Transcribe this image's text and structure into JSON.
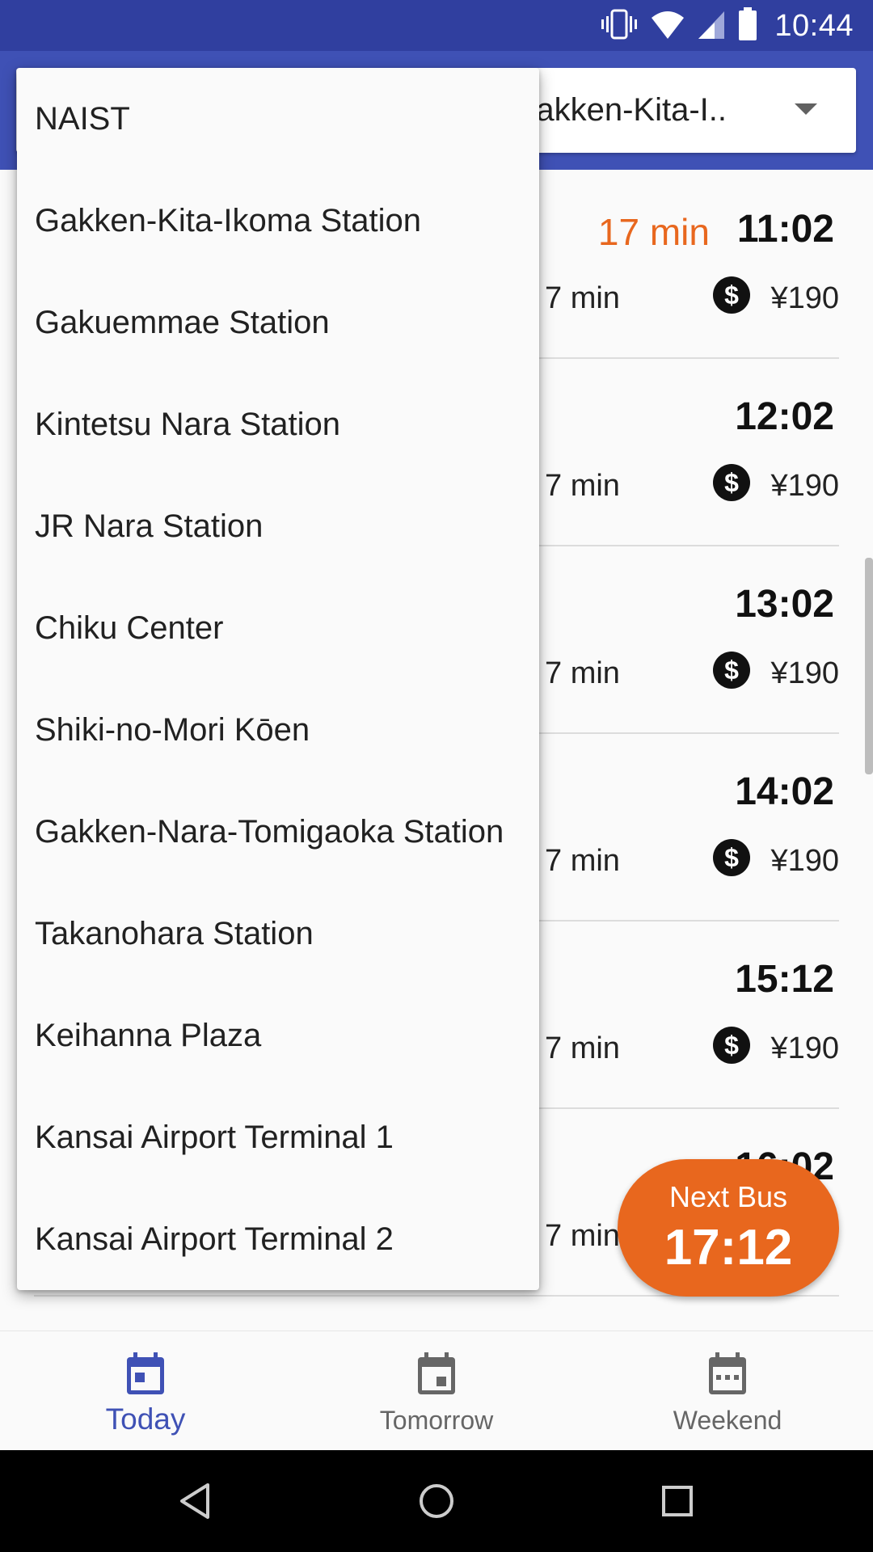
{
  "status_bar": {
    "time": "10:44",
    "icons": [
      "vibrate-icon",
      "wifi-icon",
      "signal-icon",
      "battery-icon"
    ]
  },
  "app_bar": {
    "selected_stop_display": "akken-Kita-I.."
  },
  "schedule": [
    {
      "wait": "17 min",
      "time": "11:02",
      "duration": "7 min",
      "fare": "¥190"
    },
    {
      "wait": "",
      "time": "12:02",
      "duration": "7 min",
      "fare": "¥190"
    },
    {
      "wait": "",
      "time": "13:02",
      "duration": "7 min",
      "fare": "¥190"
    },
    {
      "wait": "",
      "time": "14:02",
      "duration": "7 min",
      "fare": "¥190"
    },
    {
      "wait": "",
      "time": "15:12",
      "duration": "7 min",
      "fare": "¥190"
    },
    {
      "wait": "",
      "time": "16:02",
      "duration": "7 min",
      "fare": ""
    }
  ],
  "fab": {
    "label": "Next Bus",
    "time": "17:12"
  },
  "bottom_nav": {
    "items": [
      {
        "label": "Today",
        "active": true
      },
      {
        "label": "Tomorrow",
        "active": false
      },
      {
        "label": "Weekend",
        "active": false
      }
    ]
  },
  "dropdown": {
    "options": [
      "NAIST",
      "Gakken-Kita-Ikoma Station",
      "Gakuemmae Station",
      "Kintetsu Nara Station",
      "JR Nara Station",
      "Chiku Center",
      "Shiki-no-Mori Kōen",
      "Gakken-Nara-Tomigaoka Station",
      "Takanohara Station",
      "Keihanna Plaza",
      "Kansai Airport Terminal 1",
      "Kansai Airport Terminal 2"
    ]
  },
  "colors": {
    "primary": "#3F51B5",
    "primary_dark": "#303F9F",
    "accent": "#E8671E",
    "nav_inactive": "#666666"
  }
}
